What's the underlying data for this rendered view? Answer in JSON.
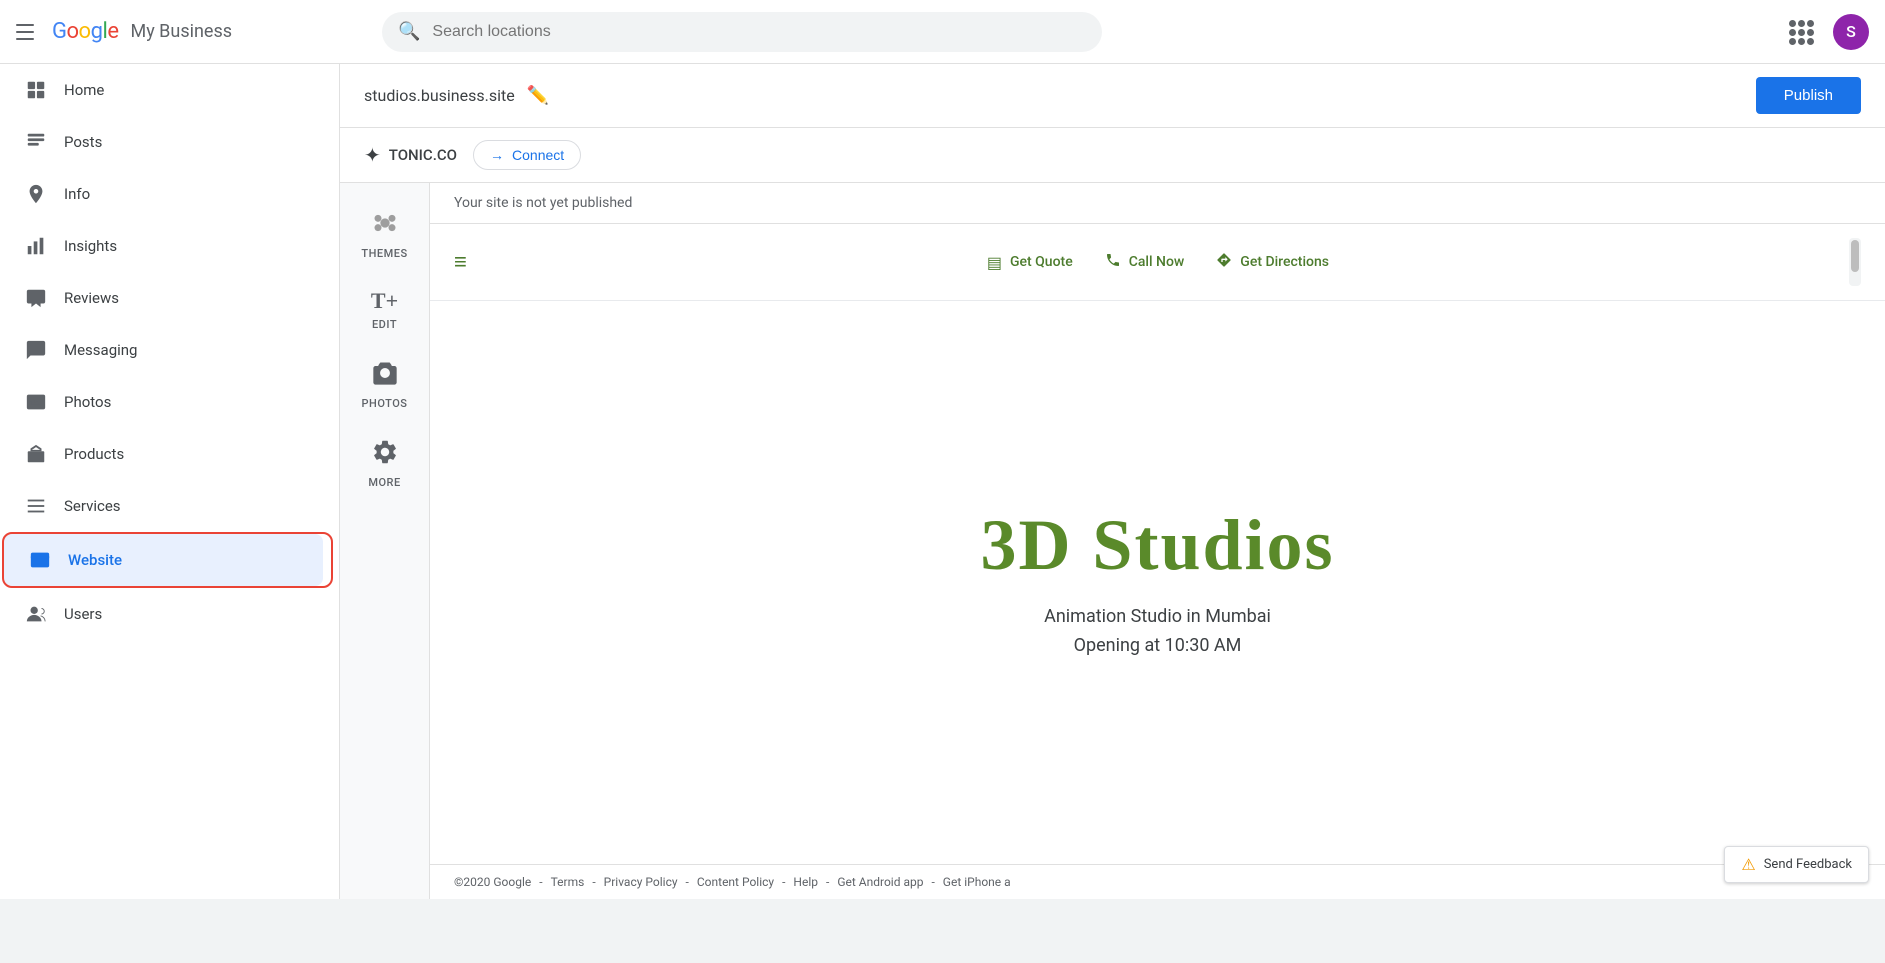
{
  "topbar": {
    "app_name": "My Business",
    "search_placeholder": "Search locations",
    "avatar_letter": "S"
  },
  "sidebar": {
    "items": [
      {
        "id": "home",
        "label": "Home",
        "icon": "⊞"
      },
      {
        "id": "posts",
        "label": "Posts",
        "icon": "▤"
      },
      {
        "id": "info",
        "label": "Info",
        "icon": "🏪"
      },
      {
        "id": "insights",
        "label": "Insights",
        "icon": "📊"
      },
      {
        "id": "reviews",
        "label": "Reviews",
        "icon": "🖼"
      },
      {
        "id": "messaging",
        "label": "Messaging",
        "icon": "💬"
      },
      {
        "id": "photos",
        "label": "Photos",
        "icon": "🖼"
      },
      {
        "id": "products",
        "label": "Products",
        "icon": "🧺"
      },
      {
        "id": "services",
        "label": "Services",
        "icon": "≡"
      },
      {
        "id": "website",
        "label": "Website",
        "icon": "⊟",
        "active": true
      },
      {
        "id": "users",
        "label": "Users",
        "icon": "👤+"
      }
    ]
  },
  "website_header": {
    "url": "studios.business.site",
    "publish_label": "Publish"
  },
  "tonic": {
    "logo_icon": "✦",
    "logo_text": "TONIC.CO",
    "connect_label": "Connect",
    "arrow": "→"
  },
  "tools": [
    {
      "id": "themes",
      "icon": "🎨",
      "label": "THEMES"
    },
    {
      "id": "edit",
      "icon": "T+",
      "label": "EDIT"
    },
    {
      "id": "photos",
      "icon": "📷",
      "label": "PHOTOS"
    },
    {
      "id": "more",
      "icon": "⚙",
      "label": "MORE"
    }
  ],
  "preview": {
    "not_published_text": "Your site is not yet published",
    "site_nav": {
      "hamburger": "≡",
      "links": [
        {
          "icon": "▤",
          "label": "Get Quote"
        },
        {
          "icon": "📞",
          "label": "Call Now"
        },
        {
          "icon": "◈",
          "label": "Get Directions"
        }
      ]
    },
    "hero": {
      "title": "3D Studios",
      "subtitle_line1": "Animation Studio in Mumbai",
      "subtitle_line2": "Opening at 10:30 AM"
    }
  },
  "footer": {
    "copyright": "©2020 Google",
    "links": [
      "Terms",
      "Privacy Policy",
      "Content Policy",
      "Help",
      "Get Android app",
      "Get iPhone a"
    ]
  },
  "send_feedback": {
    "icon": "⚠",
    "label": "Send Feedback"
  }
}
